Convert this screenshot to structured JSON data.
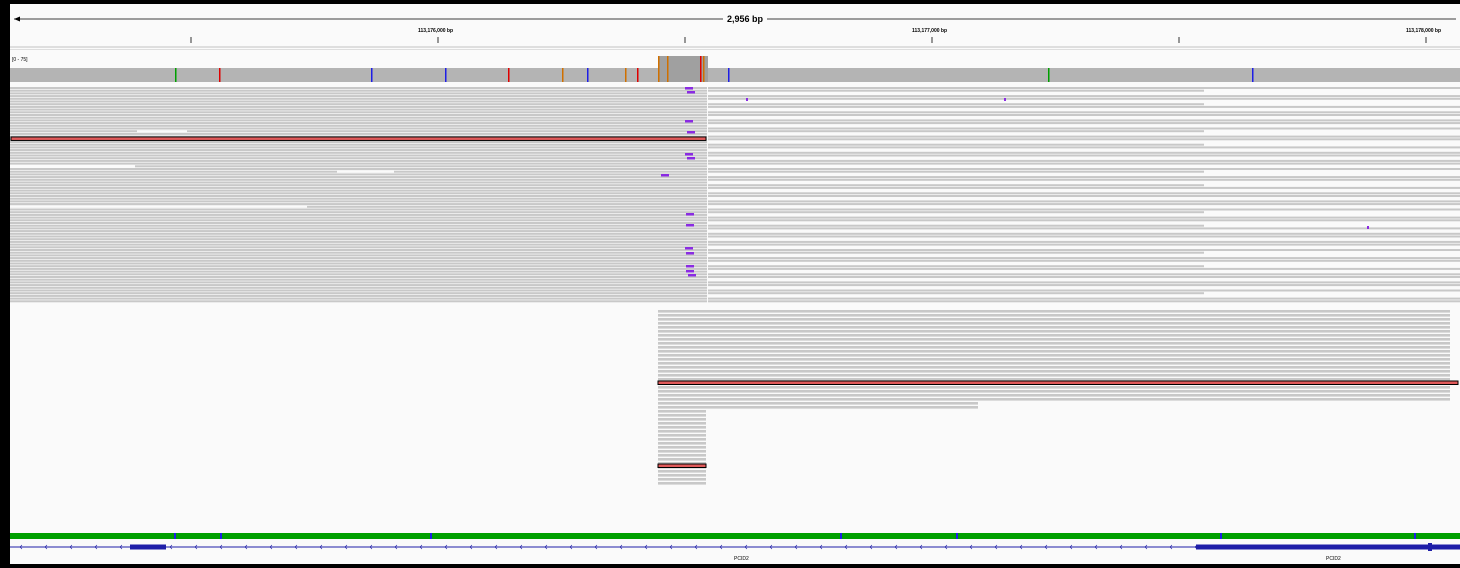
{
  "ruler": {
    "span_label": "2,956 bp",
    "ticks": [
      "113,176,000 bp",
      "113,177,000 bp",
      "113,178,000 bp"
    ]
  },
  "coverage": {
    "range_label": "[0 - 75]"
  },
  "gene_track": {
    "gene_labels": [
      "PCID2",
      "PCID2"
    ],
    "strand": "minus",
    "color": "#1e1ea8"
  },
  "colors": {
    "read": "#c8c8c8",
    "coverage": "#b4b4b4",
    "insertion": "#8a2be2",
    "discordant_fill": "#e05a5a",
    "mismatch_A": "#00a000",
    "mismatch_C": "#1e1ee6",
    "mismatch_G": "#d07000",
    "mismatch_T": "#e00000"
  }
}
